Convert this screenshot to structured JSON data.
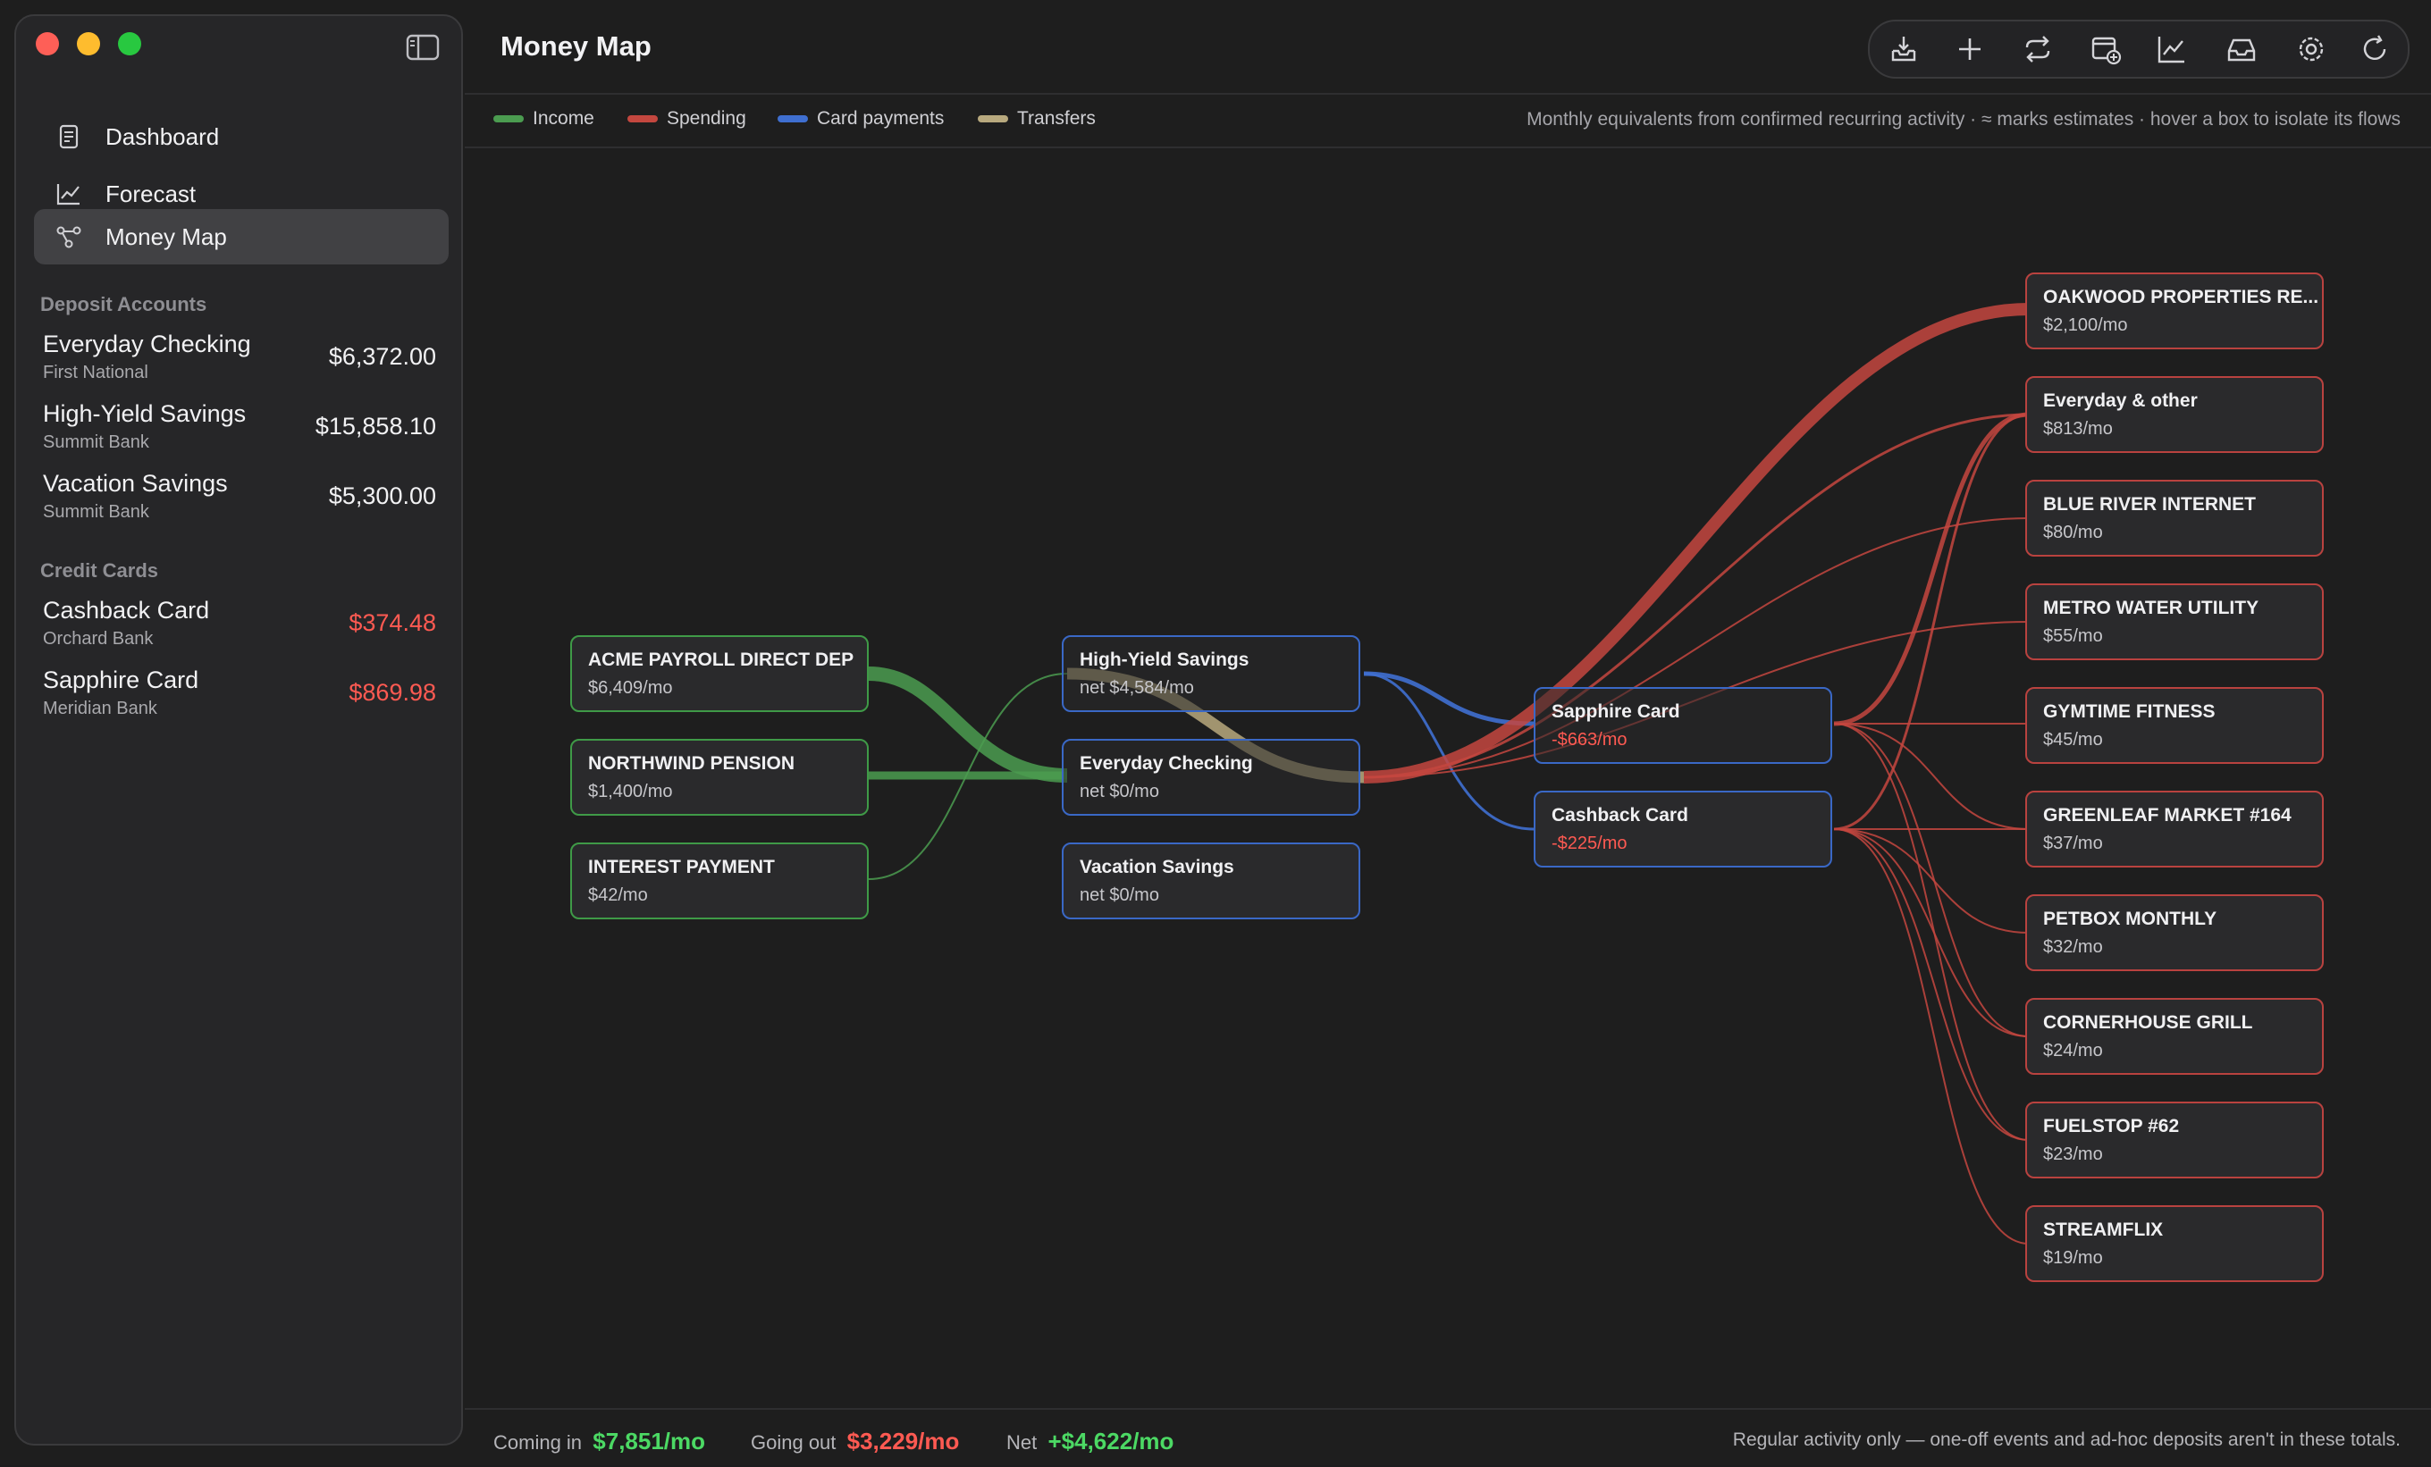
{
  "app": {
    "title": "Money Map"
  },
  "sidebar": {
    "nav": [
      {
        "label": "Dashboard",
        "icon": "document-icon"
      },
      {
        "label": "Forecast",
        "icon": "chart-line-icon"
      },
      {
        "label": "Money Map",
        "icon": "network-icon"
      }
    ],
    "deposit_header": "Deposit Accounts",
    "deposit_accounts": [
      {
        "name": "Everyday Checking",
        "institution": "First National",
        "balance": "$6,372.00"
      },
      {
        "name": "High-Yield Savings",
        "institution": "Summit Bank",
        "balance": "$15,858.10"
      },
      {
        "name": "Vacation Savings",
        "institution": "Summit Bank",
        "balance": "$5,300.00"
      }
    ],
    "credit_header": "Credit Cards",
    "credit_cards": [
      {
        "name": "Cashback Card",
        "institution": "Orchard Bank",
        "balance": "$374.48"
      },
      {
        "name": "Sapphire Card",
        "institution": "Meridian Bank",
        "balance": "$869.98"
      }
    ]
  },
  "toolbar": {
    "icons": [
      "import-icon",
      "add-icon",
      "sync-icon",
      "calendar-add-icon",
      "trend-icon",
      "inbox-icon",
      "settings-icon",
      "refresh-icon"
    ]
  },
  "legend": {
    "items": [
      {
        "label": "Income",
        "color": "#4b9c50"
      },
      {
        "label": "Spending",
        "color": "#c4473f"
      },
      {
        "label": "Card payments",
        "color": "#3f6fd0"
      },
      {
        "label": "Transfers",
        "color": "#b8a97e"
      }
    ],
    "note": "Monthly equivalents from confirmed recurring activity · ≈ marks estimates · hover a box to isolate its flows"
  },
  "map": {
    "sources": [
      {
        "title": "ACME PAYROLL DIRECT DEP",
        "value": "$6,409/mo"
      },
      {
        "title": "NORTHWIND PENSION",
        "value": "$1,400/mo"
      },
      {
        "title": "INTEREST PAYMENT",
        "value": "$42/mo"
      }
    ],
    "accounts": [
      {
        "title": "High-Yield Savings",
        "value": "net $4,584/mo"
      },
      {
        "title": "Everyday Checking",
        "value": "net $0/mo"
      },
      {
        "title": "Vacation Savings",
        "value": "net $0/mo"
      }
    ],
    "cards": [
      {
        "title": "Sapphire Card",
        "value": "-$663/mo"
      },
      {
        "title": "Cashback Card",
        "value": "-$225/mo"
      }
    ],
    "payees": [
      {
        "title": "OAKWOOD PROPERTIES RE...",
        "value": "$2,100/mo"
      },
      {
        "title": "Everyday & other",
        "value": "$813/mo"
      },
      {
        "title": "BLUE RIVER INTERNET",
        "value": "$80/mo"
      },
      {
        "title": "METRO WATER UTILITY",
        "value": "$55/mo"
      },
      {
        "title": "GYMTIME FITNESS",
        "value": "$45/mo"
      },
      {
        "title": "GREENLEAF MARKET #164",
        "value": "$37/mo"
      },
      {
        "title": "PETBOX MONTHLY",
        "value": "$32/mo"
      },
      {
        "title": "CORNERHOUSE GRILL",
        "value": "$24/mo"
      },
      {
        "title": "FUELSTOP #62",
        "value": "$23/mo"
      },
      {
        "title": "STREAMFLIX",
        "value": "$19/mo"
      }
    ]
  },
  "footer": {
    "in_label": "Coming in",
    "in_value": "$7,851/mo",
    "out_label": "Going out",
    "out_value": "$3,229/mo",
    "net_label": "Net",
    "net_value": "+$4,622/mo",
    "note": "Regular activity only — one-off events and ad-hoc deposits aren't in these totals."
  }
}
